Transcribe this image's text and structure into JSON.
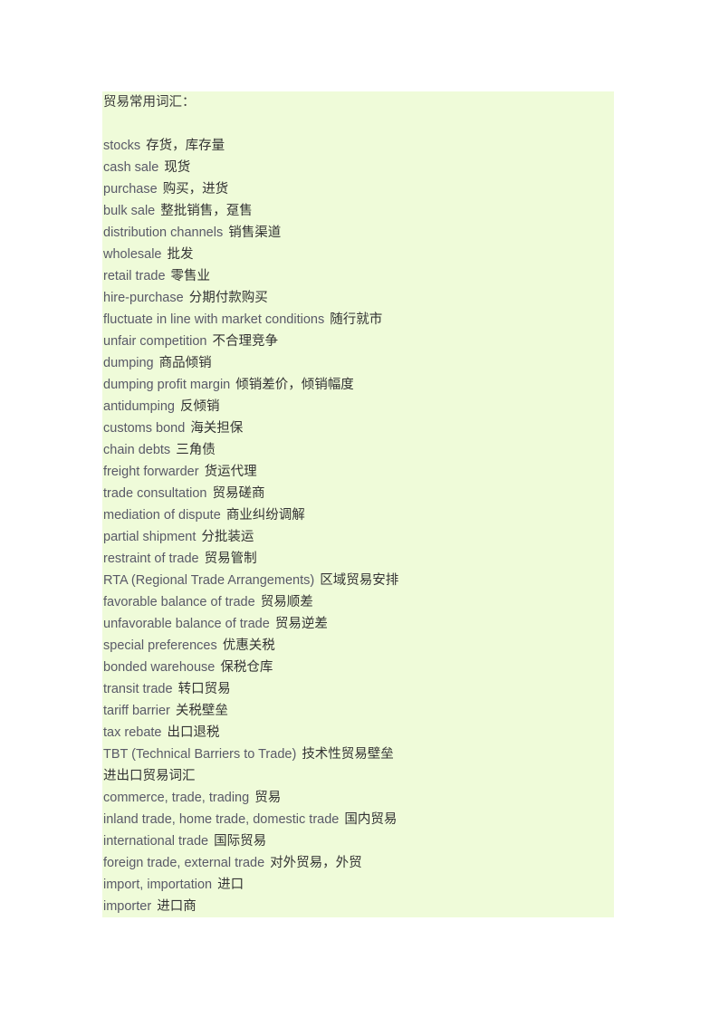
{
  "document": {
    "title": "贸易常用词汇：",
    "background_color": "#effbd9",
    "page_background_color": "#ffffff",
    "english_text_color": "#595968",
    "chinese_text_color": "#333333",
    "blank_line": ""
  },
  "entries": [
    {
      "en": "stocks",
      "zh": "存货，库存量"
    },
    {
      "en": "cash sale",
      "zh": "现货"
    },
    {
      "en": "purchase",
      "zh": "购买，进货"
    },
    {
      "en": "bulk sale",
      "zh": "整批销售，趸售"
    },
    {
      "en": "distribution channels",
      "zh": "销售渠道"
    },
    {
      "en": "wholesale",
      "zh": "批发"
    },
    {
      "en": "retail trade",
      "zh": "零售业"
    },
    {
      "en": "hire-purchase",
      "zh": "分期付款购买"
    },
    {
      "en": "fluctuate in line with market conditions",
      "zh": "随行就市"
    },
    {
      "en": "unfair competition",
      "zh": "不合理竞争"
    },
    {
      "en": "dumping",
      "zh": "商品倾销"
    },
    {
      "en": "dumping profit margin",
      "zh": "倾销差价，倾销幅度"
    },
    {
      "en": "antidumping",
      "zh": "反倾销"
    },
    {
      "en": "customs bond",
      "zh": "海关担保"
    },
    {
      "en": "chain debts",
      "zh": "三角债"
    },
    {
      "en": "freight forwarder",
      "zh": "货运代理"
    },
    {
      "en": "trade consultation",
      "zh": "贸易磋商"
    },
    {
      "en": "mediation of dispute",
      "zh": "商业纠纷调解"
    },
    {
      "en": "partial shipment",
      "zh": "分批装运"
    },
    {
      "en": "restraint of trade",
      "zh": "贸易管制"
    },
    {
      "en": "RTA (Regional Trade Arrangements)",
      "zh": "区域贸易安排"
    },
    {
      "en": "favorable balance of trade",
      "zh": "贸易顺差"
    },
    {
      "en": "unfavorable balance of trade",
      "zh": "贸易逆差"
    },
    {
      "en": "special preferences",
      "zh": "优惠关税"
    },
    {
      "en": "bonded warehouse",
      "zh": "保税仓库"
    },
    {
      "en": "transit trade",
      "zh": "转口贸易"
    },
    {
      "en": "tariff barrier",
      "zh": "关税壁垒"
    },
    {
      "en": "tax rebate",
      "zh": "出口退税"
    },
    {
      "en": "TBT (Technical Barriers to Trade)",
      "zh": "技术性贸易壁垒"
    },
    {
      "en": "",
      "zh": "进出口贸易词汇"
    },
    {
      "en": "commerce, trade, trading",
      "zh": "贸易"
    },
    {
      "en": "inland trade, home trade, domestic trade",
      "zh": "国内贸易"
    },
    {
      "en": "international trade",
      "zh": "国际贸易"
    },
    {
      "en": "foreign trade, external trade",
      "zh": "对外贸易，外贸"
    },
    {
      "en": "import, importation",
      "zh": "进口"
    },
    {
      "en": "importer",
      "zh": "进口商"
    }
  ]
}
